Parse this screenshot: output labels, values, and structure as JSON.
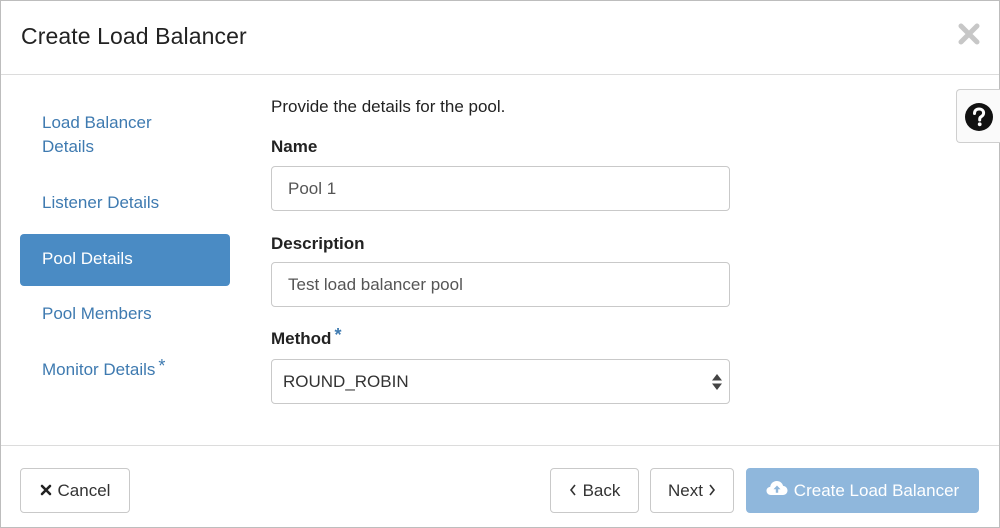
{
  "dialog": {
    "title": "Create Load Balancer"
  },
  "nav": {
    "items": [
      {
        "label": "Load Balancer Details",
        "line1": "Load Balancer",
        "line2": "Details",
        "active": false,
        "required": false
      },
      {
        "label": "Listener Details",
        "active": false,
        "required": false
      },
      {
        "label": "Pool Details",
        "active": true,
        "required": false
      },
      {
        "label": "Pool Members",
        "active": false,
        "required": false
      },
      {
        "label": "Monitor Details",
        "active": false,
        "required": true
      }
    ],
    "required_marker": "*"
  },
  "form": {
    "intro": "Provide the details for the pool.",
    "name": {
      "label": "Name",
      "value": "Pool 1"
    },
    "description": {
      "label": "Description",
      "value": "Test load balancer pool"
    },
    "method": {
      "label": "Method",
      "required_marker": "*",
      "value": "ROUND_ROBIN"
    }
  },
  "footer": {
    "cancel_label": "Cancel",
    "back_label": "Back",
    "next_label": "Next",
    "create_label": "Create Load Balancer"
  },
  "icons": {
    "close": "close-icon",
    "help": "question-circle-icon",
    "cancel": "times-icon",
    "back": "chevron-left-icon",
    "next": "chevron-right-icon",
    "create": "cloud-upload-icon",
    "select": "sort-arrows-icon"
  },
  "colors": {
    "accent": "#4a8bc4",
    "link": "#3e7ab0",
    "primary_disabled": "#8fb7dc"
  }
}
